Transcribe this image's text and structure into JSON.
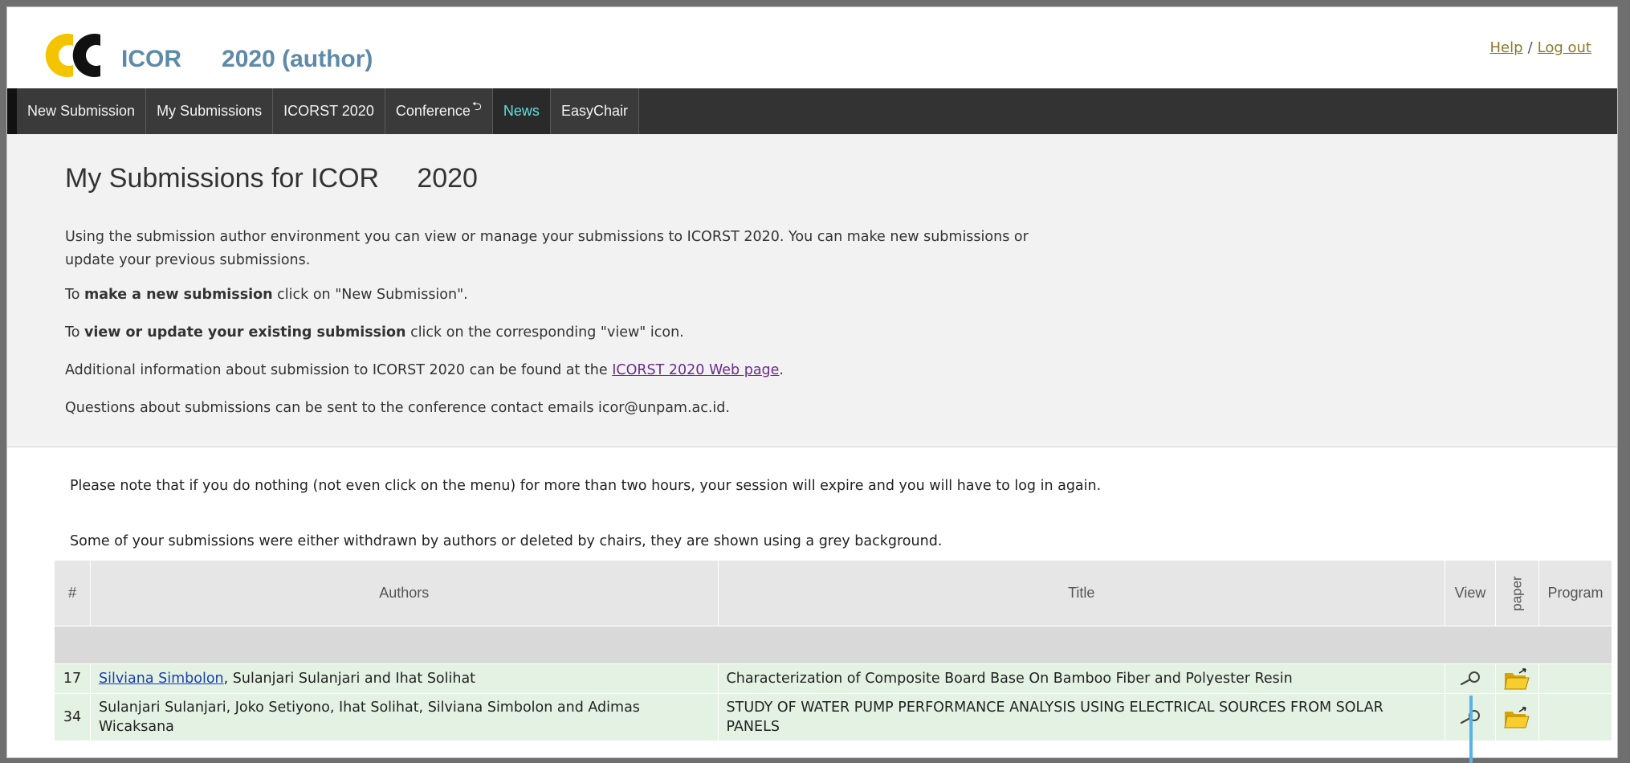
{
  "header": {
    "logo_text": "EC",
    "app_title_part1": "ICOR",
    "app_title_part2": "2020 (author)",
    "help_label": "Help",
    "separator": "/",
    "logout_label": "Log out"
  },
  "menu": {
    "items": [
      {
        "label": "New Submission"
      },
      {
        "label": "My Submissions"
      },
      {
        "label": "ICORST 2020"
      },
      {
        "label": "Conference",
        "suffix": "⮌"
      },
      {
        "label": "News"
      },
      {
        "label": "EasyChair"
      }
    ]
  },
  "intro": {
    "title_part1": "My Submissions for ICOR",
    "title_part2": "2020",
    "para1": "Using the submission author environment you can view or manage your submissions to ICORST 2020. You can make new submissions or update your previous submissions.",
    "para2_prefix": "To ",
    "para2_bold": "make a new submission",
    "para2_suffix": " click on \"New Submission\".",
    "para3_prefix": "To ",
    "para3_bold": "view or update your existing submission",
    "para3_suffix": " click on the corresponding \"view\" icon.",
    "para4_prefix": "Additional information about submission to ICORST 2020 can be found at the ",
    "para4_link": "ICORST 2020 Web page",
    "para4_suffix": ".",
    "para5": "Questions about submissions can be sent to the conference contact emails icor@unpam.ac.id."
  },
  "notes": {
    "session": "Please note that if you do nothing (not even click on the menu) for more than two hours, your session will expire and you will have to log in again.",
    "withdrawn": "Some of your submissions were either withdrawn by authors or deleted by chairs, they are shown using a grey background."
  },
  "table": {
    "headers": {
      "num": "#",
      "authors": "Authors",
      "title": "Title",
      "view": "View",
      "paper": "paper",
      "program": "Program"
    },
    "rows": [
      {
        "num": "17",
        "author_link": "Silviana Simbolon",
        "authors_rest": ", Sulanjari Sulanjari and Ihat Solihat",
        "title": "Characterization of Composite Board Base On Bamboo Fiber and Polyester Resin"
      },
      {
        "num": "34",
        "author_link": "",
        "authors_rest": "Sulanjari Sulanjari, Joko Setiyono, Ihat Solihat, Silviana Simbolon and Adimas Wicaksana",
        "title": "STUDY OF WATER PUMP PERFORMANCE ANALYSIS USING ELECTRICAL SOURCES FROM SOLAR PANELS"
      }
    ]
  },
  "icons": {
    "logo": "easychair-logo-icon",
    "view": "magnifier-icon",
    "paper": "folder-upload-icon"
  },
  "colors": {
    "menu_bg": "#333333",
    "menu_active": "#5fe0e0",
    "title_blue": "#5d8aa8",
    "row_green": "#e4f2e4",
    "logo_yellow": "#f5c400"
  }
}
